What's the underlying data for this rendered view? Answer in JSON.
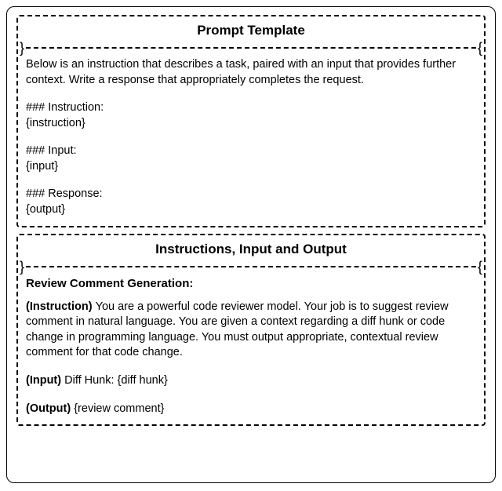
{
  "section1": {
    "title": "Prompt Template",
    "intro": "Below is an instruction that describes a task, paired with an input that provides further context. Write a response that appropriately completes the request.",
    "instr_header": "### Instruction:",
    "instr_val": "{instruction}",
    "input_header": "### Input:",
    "input_val": "{input}",
    "resp_header": "### Response:",
    "resp_val": "{output}"
  },
  "section2": {
    "title": "Instructions, Input and Output",
    "subheading": "Review Comment Generation:",
    "instr_label": "(Instruction) ",
    "instr_text": "You are a powerful code reviewer model. Your job is to suggest review comment in natural language. You are given a context regarding a diff hunk or code change in programming language. You must output appropriate, contextual review comment for that code change.",
    "input_label": "(Input) ",
    "input_text": "Diff Hunk: {diff hunk}",
    "output_label": "(Output) ",
    "output_text": "{review comment}"
  }
}
